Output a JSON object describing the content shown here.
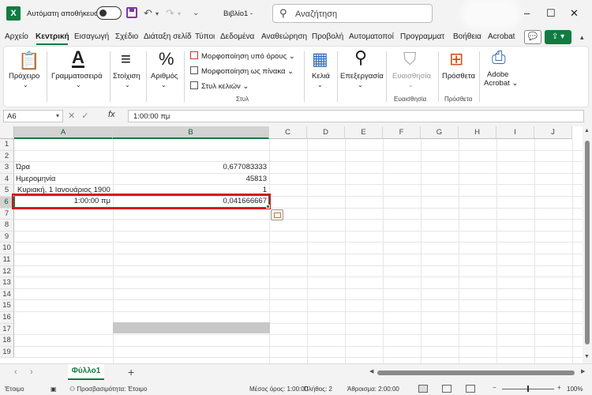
{
  "titlebar": {
    "app_logo": "X",
    "autosave_label": "Αυτόματη αποθήκευση",
    "doc_title": "Βιβλίο1  -",
    "search_placeholder": "Αναζήτηση",
    "icons": [
      "save-icon",
      "undo-icon",
      "redo-icon",
      "customize-icon"
    ]
  },
  "menu": {
    "items": [
      "Αρχείο",
      "Κεντρική",
      "Εισαγωγή",
      "Σχέδιο",
      "Διάταξη σελίδ",
      "Τύποι",
      "Δεδομένα",
      "Αναθεώρηση",
      "Προβολή",
      "Αυτοματοποί",
      "Προγραμματ",
      "Βοήθεια",
      "Acrobat"
    ],
    "active": "Κεντρική"
  },
  "ribbon": {
    "clipboard": "Πρόχειρο",
    "font": "Γραμματοσειρά",
    "alignment": "Στοίχιση",
    "number": "Αριθμός",
    "cond_format": "Μορφοποίηση υπό όρους",
    "format_table": "Μορφοποίηση ως πίνακα",
    "cell_styles": "Στυλ κελιών",
    "styles_group": "Στυλ",
    "cells": "Κελιά",
    "editing": "Επεξεργασία",
    "sensitivity": "Ευαισθησία",
    "sensitivity_group": "Ευαισθησία",
    "addins": "Πρόσθετα",
    "addins_group": "Πρόσθετα",
    "adobe_1": "Adobe",
    "adobe_2": "Acrobat"
  },
  "formula_bar": {
    "name_box": "A6",
    "fx": "fx",
    "value": "1:00:00 πμ"
  },
  "columns": [
    "A",
    "B",
    "C",
    "D",
    "E",
    "F",
    "G",
    "H",
    "I",
    "J"
  ],
  "rows": [
    "1",
    "2",
    "3",
    "4",
    "5",
    "6",
    "7",
    "8",
    "9",
    "10",
    "11",
    "12",
    "13",
    "14",
    "15",
    "16",
    "17",
    "18",
    "19"
  ],
  "cells": {
    "A3": "Ώρα",
    "B3": "0,677083333",
    "A4": "Ημερομηνία",
    "B4": "45813",
    "A5": "Κυριακή, 1 Ιανουάριος 1900",
    "B5": "1",
    "A6": "1:00:00 πμ",
    "B6": "0,041666667"
  },
  "sheet": {
    "tab": "Φύλλο1",
    "add": "+"
  },
  "status": {
    "ready": "Έτοιμο",
    "accessibility": "Προσβασιμότητα: Έτοιμο",
    "average": "Μέσος όρος: 1:00:00",
    "count": "Πλήθος: 2",
    "sum": "Άθροισμα: 2:00:00",
    "zoom": "100%"
  },
  "colors": {
    "accent": "#107c41",
    "highlight_box": "#d0141a"
  }
}
